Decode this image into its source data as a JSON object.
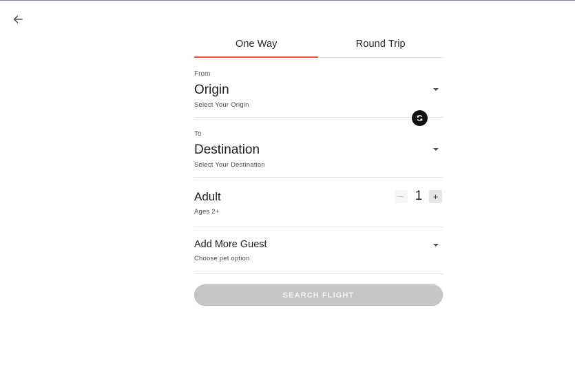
{
  "icons": {
    "back": "arrow-left-icon",
    "swap": "swap-icon",
    "caret": "caret-down-icon"
  },
  "colors": {
    "accent": "#f0522d",
    "disabled_button": "#c6c5c8"
  },
  "tabs": [
    {
      "label": "One Way",
      "active": true
    },
    {
      "label": "Round Trip",
      "active": false
    }
  ],
  "from": {
    "label": "From",
    "value": "Origin",
    "helper": "Select Your Origin"
  },
  "to": {
    "label": "To",
    "value": "Destination",
    "helper": "Select Your Destination"
  },
  "adult": {
    "label": "Adult",
    "helper": "Ages 2+",
    "minus": "−",
    "count": "1",
    "plus": "+"
  },
  "guest": {
    "label": "Add More Guest",
    "helper": "Choose pet option"
  },
  "search_button": "SEARCH FLIGHT"
}
